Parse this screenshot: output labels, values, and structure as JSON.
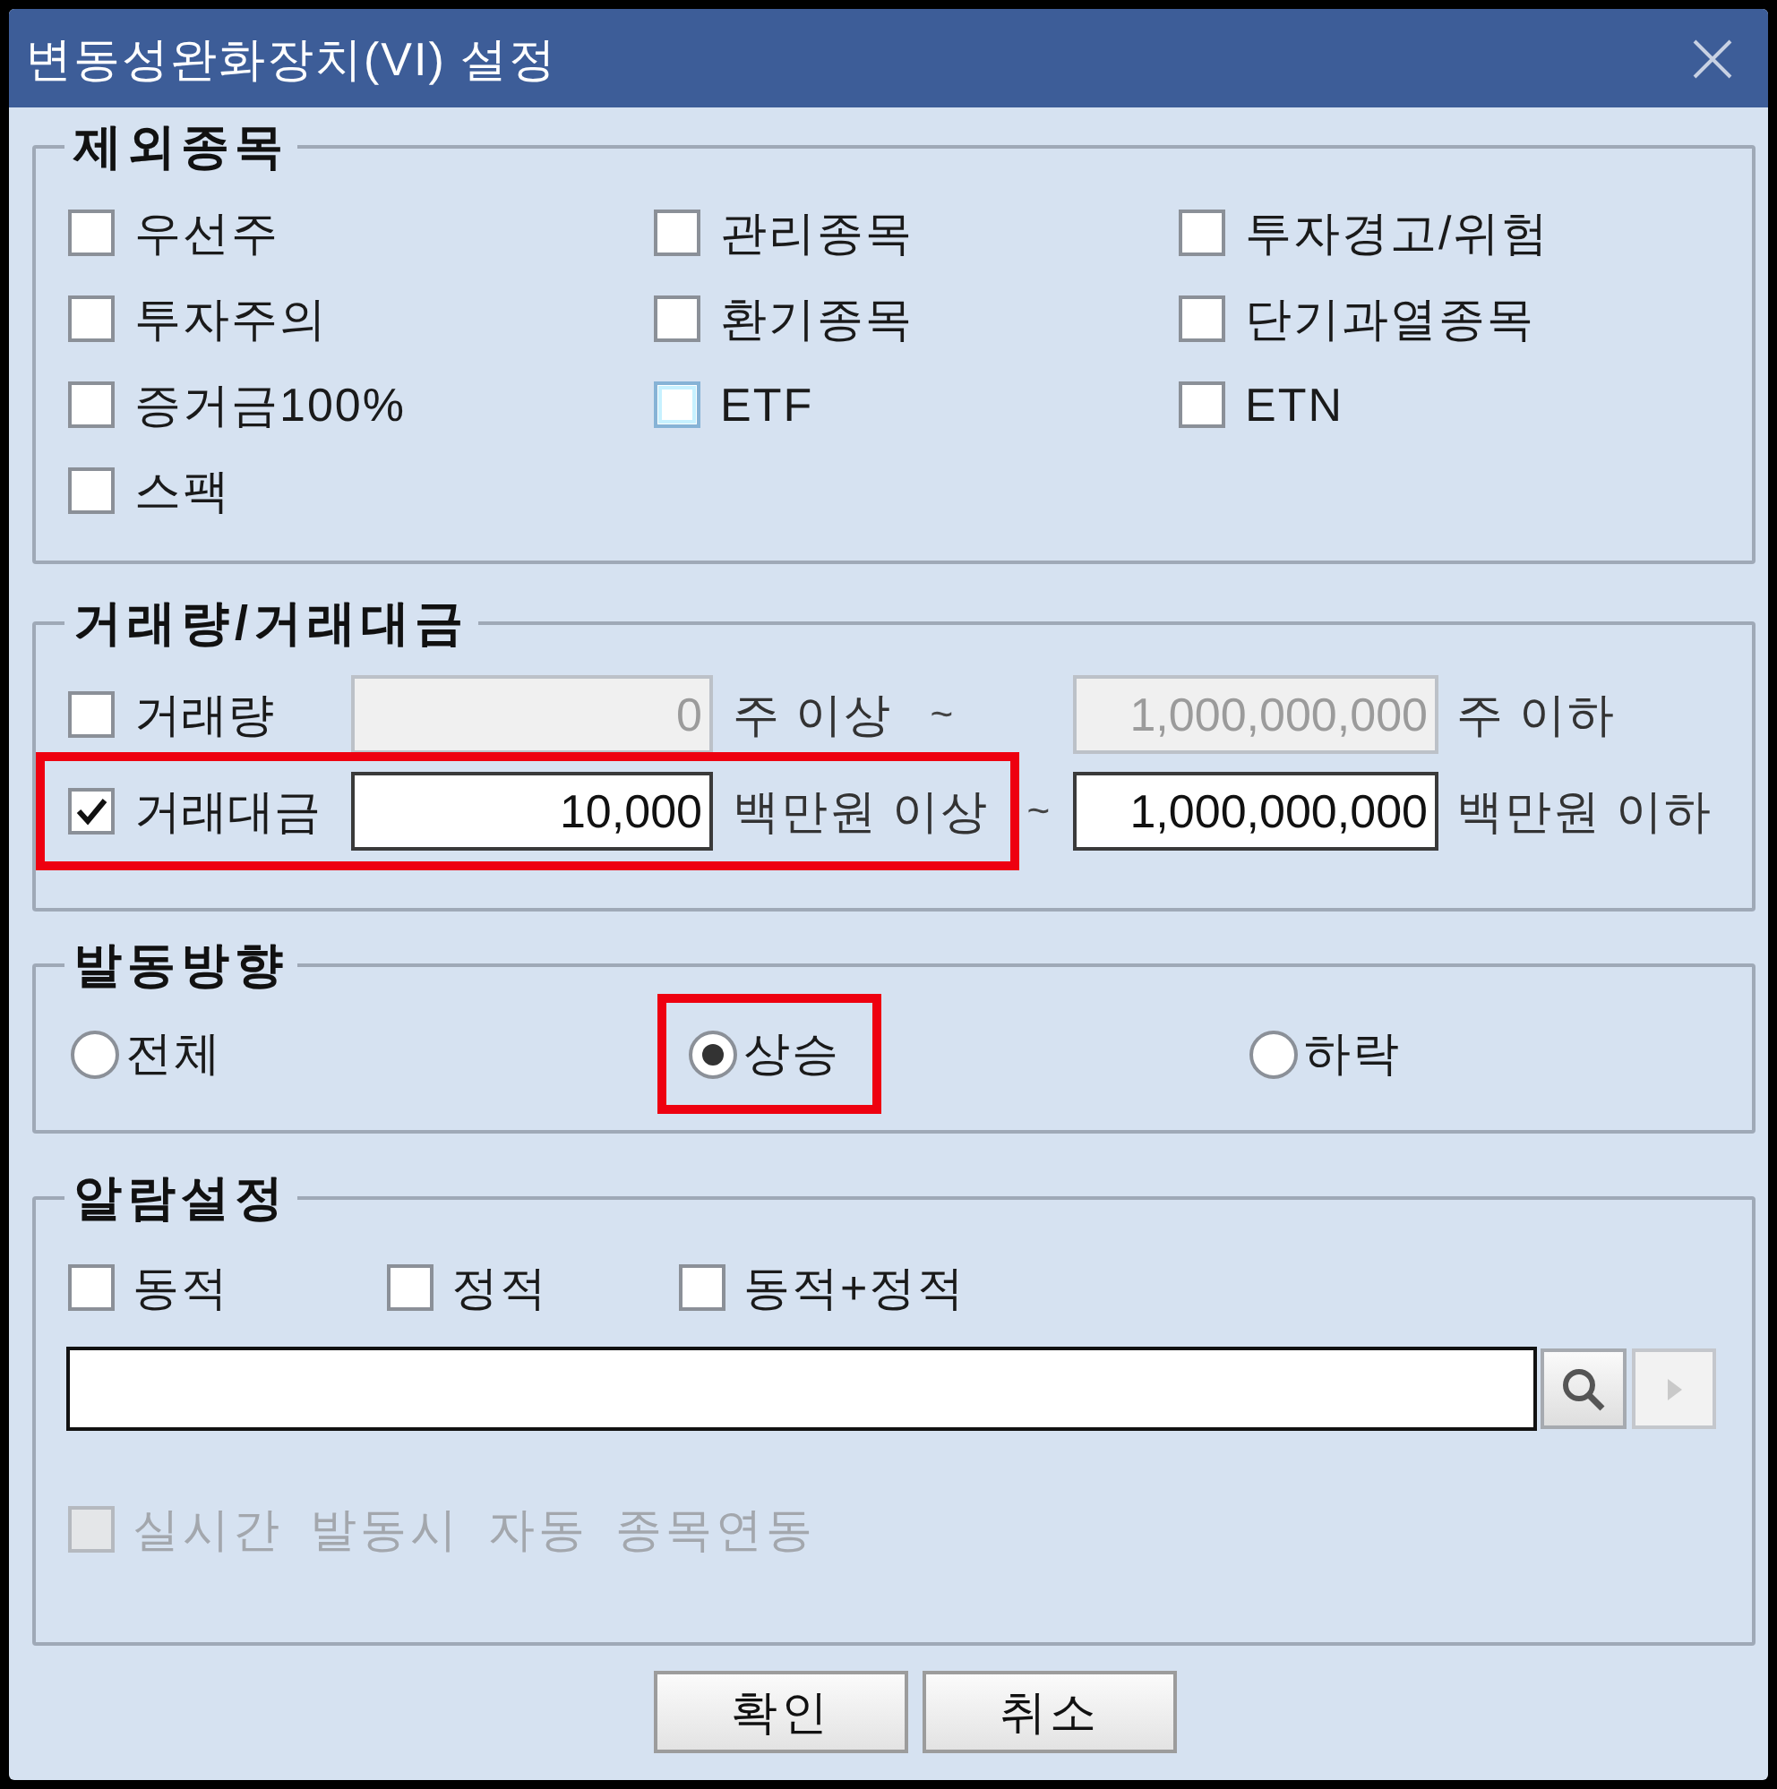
{
  "window": {
    "title": "변동성완화장치(VI) 설정"
  },
  "exclusions": {
    "legend": "제외종목",
    "items": [
      {
        "label": "우선주",
        "checked": false,
        "hovered": false
      },
      {
        "label": "관리종목",
        "checked": false,
        "hovered": false
      },
      {
        "label": "투자경고/위험",
        "checked": false,
        "hovered": false
      },
      {
        "label": "투자주의",
        "checked": false,
        "hovered": false
      },
      {
        "label": "환기종목",
        "checked": false,
        "hovered": false
      },
      {
        "label": "단기과열종목",
        "checked": false,
        "hovered": false
      },
      {
        "label": "증거금100%",
        "checked": false,
        "hovered": false
      },
      {
        "label": "ETF",
        "checked": false,
        "hovered": true
      },
      {
        "label": "ETN",
        "checked": false,
        "hovered": false
      },
      {
        "label": "스팩",
        "checked": false,
        "hovered": false
      }
    ]
  },
  "volume": {
    "legend": "거래량/거래대금",
    "rows": [
      {
        "label": "거래량",
        "checked": false,
        "highlighted": false,
        "min_value": "0",
        "min_unit": "주 이상",
        "separator": "~",
        "max_value": "1,000,000,000",
        "max_unit": "주 이하"
      },
      {
        "label": "거래대금",
        "checked": true,
        "highlighted": true,
        "min_value": "10,000",
        "min_unit": "백만원 이상",
        "separator": "~",
        "max_value": "1,000,000,000",
        "max_unit": "백만원 이하"
      }
    ]
  },
  "direction": {
    "legend": "발동방향",
    "options": [
      {
        "label": "전체",
        "selected": false,
        "highlighted": false
      },
      {
        "label": "상승",
        "selected": true,
        "highlighted": true
      },
      {
        "label": "하락",
        "selected": false,
        "highlighted": false
      }
    ]
  },
  "alarm": {
    "legend": "알람설정",
    "items": [
      {
        "label": "동적",
        "checked": false
      },
      {
        "label": "정적",
        "checked": false
      },
      {
        "label": "동적+정적",
        "checked": false
      }
    ],
    "next_button": {
      "disabled": true
    },
    "auto_link": {
      "label": "실시간 발동시 자동 종목연동",
      "checked": false,
      "disabled": true
    }
  },
  "buttons": [
    {
      "label": "확인"
    },
    {
      "label": "취소"
    }
  ]
}
